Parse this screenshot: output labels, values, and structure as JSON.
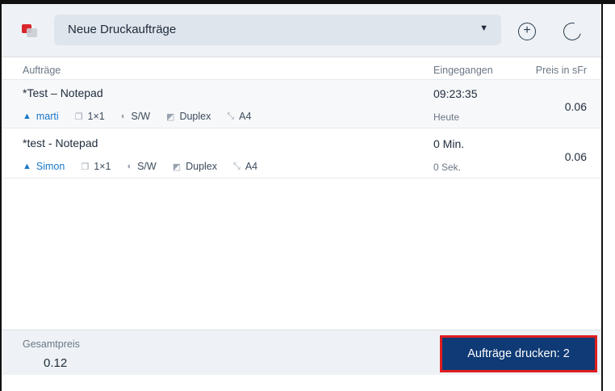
{
  "header": {
    "queue_select_value": "Neue Druckaufträge",
    "add_icon": "plus-circle-icon",
    "refresh_icon": "refresh-icon"
  },
  "table": {
    "columns": {
      "jobs": "Aufträge",
      "received": "Eingegangen",
      "price": "Preis in sFr"
    },
    "rows": [
      {
        "name": "*Test – Notepad",
        "user": "marti",
        "pages": "1×1",
        "color": "S/W",
        "duplex": "Duplex",
        "format": "A4",
        "time": "09:23:35",
        "day": "Heute",
        "price": "0.06"
      },
      {
        "name": "*test - Notepad",
        "user": "Simon",
        "pages": "1×1",
        "color": "S/W",
        "duplex": "Duplex",
        "format": "A4",
        "time": "0 Min.",
        "day": "0 Sek.",
        "price": "0.06"
      }
    ]
  },
  "footer": {
    "total_label": "Gesamtpreis",
    "total_value": "0.12",
    "print_button_label": "Aufträge drucken: 2"
  },
  "colors": {
    "accent": "#0f3a75",
    "highlight_border": "#e01d20",
    "user_link": "#1976c8"
  }
}
